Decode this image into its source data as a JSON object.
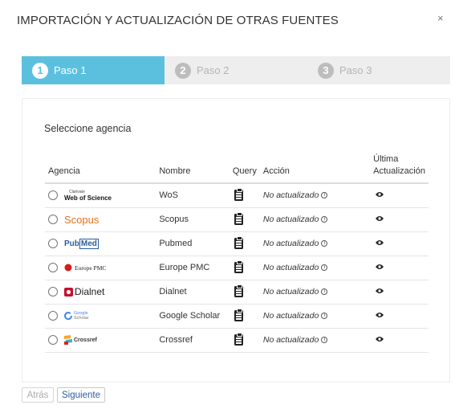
{
  "modal": {
    "title": "IMPORTACIÓN Y ACTUALIZACIÓN DE OTRAS FUENTES",
    "close_symbol": "×"
  },
  "stepper": {
    "steps": [
      {
        "number": "1",
        "label": "Paso 1",
        "active": true
      },
      {
        "number": "2",
        "label": "Paso 2",
        "active": false
      },
      {
        "number": "3",
        "label": "Paso 3",
        "active": false
      }
    ]
  },
  "panel": {
    "heading": "Seleccione agencia"
  },
  "table": {
    "headers": {
      "agency": "Agencia",
      "name": "Nombre",
      "query": "Query",
      "action": "Acción",
      "last_update_1": "Última",
      "last_update_2": "Actualización"
    },
    "rows": [
      {
        "logo": "Web of Science",
        "logo_top": "Clarivate",
        "name": "WoS",
        "action": "No actualizado",
        "query_icon": "clipboard-icon",
        "last_icon": "eye-icon"
      },
      {
        "logo": "Scopus",
        "name": "Scopus",
        "action": "No actualizado",
        "query_icon": "clipboard-icon",
        "last_icon": "eye-icon"
      },
      {
        "logo_a": "Pub",
        "logo_b": "Med",
        "name": "Pubmed",
        "action": "No actualizado",
        "query_icon": "clipboard-icon",
        "last_icon": "eye-icon"
      },
      {
        "logo": "Europe PMC",
        "name": "Europe PMC",
        "action": "No actualizado",
        "query_icon": "clipboard-icon",
        "last_icon": "eye-icon"
      },
      {
        "logo": "Dialnet",
        "name": "Dialnet",
        "action": "No actualizado",
        "query_icon": "clipboard-icon",
        "last_icon": "eye-icon"
      },
      {
        "logo_a": "Google",
        "logo_b": "Scholar",
        "name": "Google Scholar",
        "action": "No actualizado",
        "query_icon": "clipboard-icon",
        "last_icon": "eye-icon"
      },
      {
        "logo": "Crossref",
        "name": "Crossref",
        "action": "No actualizado",
        "query_icon": "clipboard-icon",
        "last_icon": "eye-icon"
      }
    ]
  },
  "footer": {
    "prev_label": "Atrás",
    "next_label": "Siguiente"
  },
  "colors": {
    "active_step": "#5bc0de",
    "inactive_step_bg": "#eeeeee",
    "scopus": "#e9711c",
    "pubmed": "#2a5d9f",
    "europepmc": "#d91a1a",
    "dialnet": "#c8102e",
    "crossref": "#3eb1c8"
  }
}
